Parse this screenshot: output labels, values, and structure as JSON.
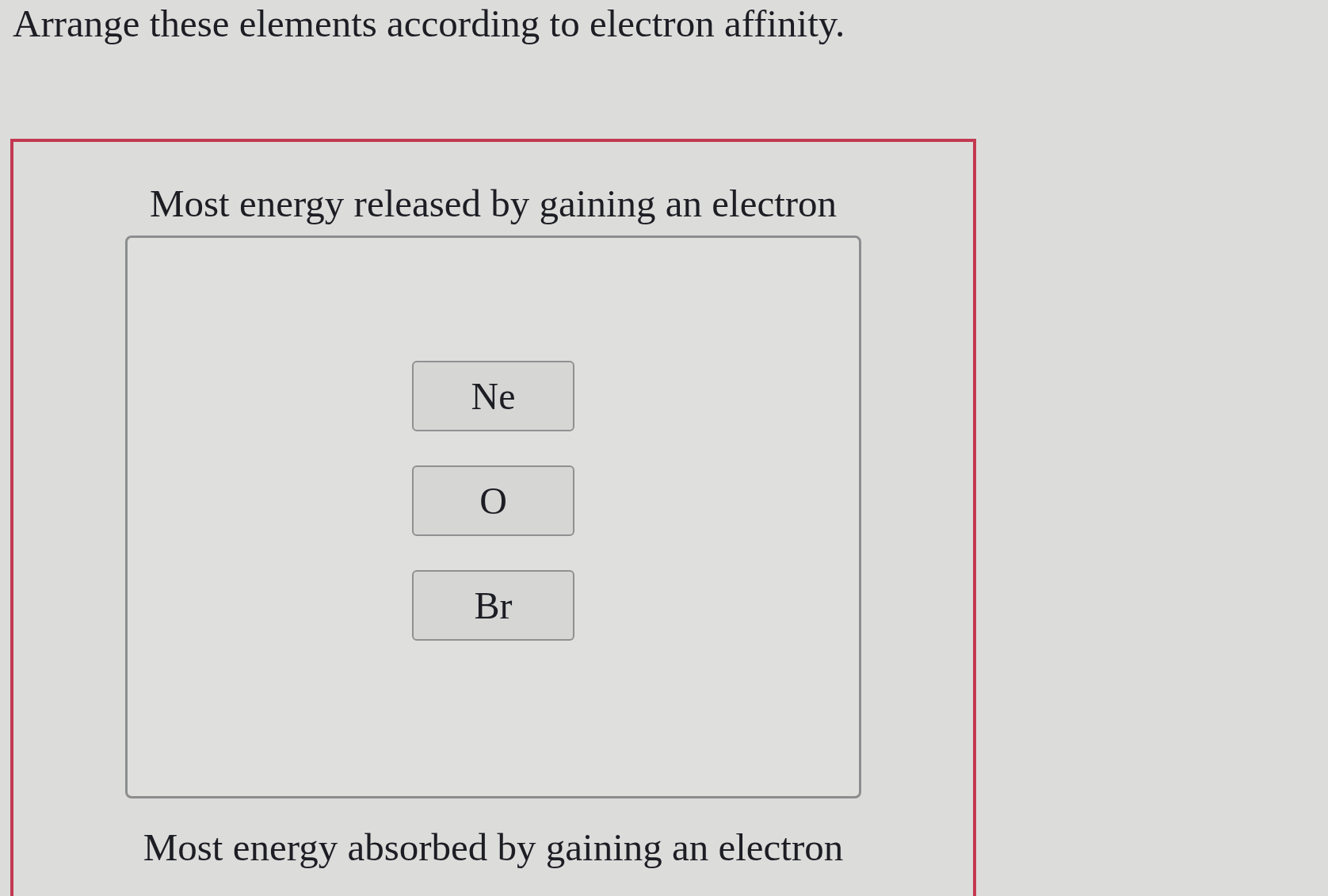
{
  "instruction": "Arrange these elements according to electron affinity.",
  "ranking": {
    "top_label": "Most energy released by gaining an electron",
    "items": [
      "Ne",
      "O",
      "Br"
    ],
    "bottom_label": "Most energy absorbed by gaining an electron"
  }
}
